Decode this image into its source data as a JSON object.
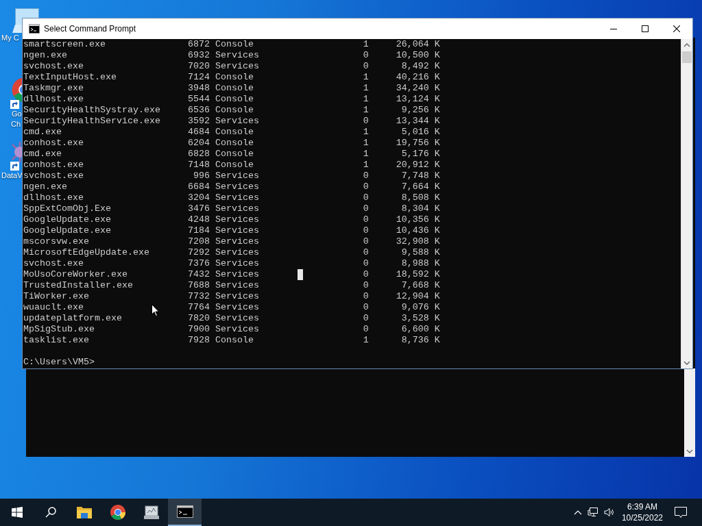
{
  "desktop_icons": [
    {
      "kind": "computer",
      "label_lines": [
        "My C"
      ]
    },
    {
      "kind": "browser",
      "label_lines": [
        "Go",
        "Ch"
      ]
    },
    {
      "kind": "dataview",
      "label_lines": [
        "DataV"
      ]
    }
  ],
  "console_window": {
    "title": "Select Command Prompt",
    "rows": [
      {
        "name": "smartscreen.exe",
        "pid": "6872",
        "session_name": "Console",
        "session_num": "1",
        "mem_usage": "26,064 K"
      },
      {
        "name": "ngen.exe",
        "pid": "6932",
        "session_name": "Services",
        "session_num": "0",
        "mem_usage": "10,500 K"
      },
      {
        "name": "svchost.exe",
        "pid": "7020",
        "session_name": "Services",
        "session_num": "0",
        "mem_usage": "8,492 K"
      },
      {
        "name": "TextInputHost.exe",
        "pid": "7124",
        "session_name": "Console",
        "session_num": "1",
        "mem_usage": "40,216 K"
      },
      {
        "name": "Taskmgr.exe",
        "pid": "3948",
        "session_name": "Console",
        "session_num": "1",
        "mem_usage": "34,240 K"
      },
      {
        "name": "dllhost.exe",
        "pid": "5544",
        "session_name": "Console",
        "session_num": "1",
        "mem_usage": "13,124 K"
      },
      {
        "name": "SecurityHealthSystray.exe",
        "pid": "6536",
        "session_name": "Console",
        "session_num": "1",
        "mem_usage": "9,256 K"
      },
      {
        "name": "SecurityHealthService.exe",
        "pid": "3592",
        "session_name": "Services",
        "session_num": "0",
        "mem_usage": "13,344 K"
      },
      {
        "name": "cmd.exe",
        "pid": "4684",
        "session_name": "Console",
        "session_num": "1",
        "mem_usage": "5,016 K"
      },
      {
        "name": "conhost.exe",
        "pid": "6204",
        "session_name": "Console",
        "session_num": "1",
        "mem_usage": "19,756 K"
      },
      {
        "name": "cmd.exe",
        "pid": "6828",
        "session_name": "Console",
        "session_num": "1",
        "mem_usage": "5,176 K"
      },
      {
        "name": "conhost.exe",
        "pid": "7148",
        "session_name": "Console",
        "session_num": "1",
        "mem_usage": "20,912 K"
      },
      {
        "name": "svchost.exe",
        "pid": "996",
        "session_name": "Services",
        "session_num": "0",
        "mem_usage": "7,748 K"
      },
      {
        "name": "ngen.exe",
        "pid": "6684",
        "session_name": "Services",
        "session_num": "0",
        "mem_usage": "7,664 K"
      },
      {
        "name": "dllhost.exe",
        "pid": "3204",
        "session_name": "Services",
        "session_num": "0",
        "mem_usage": "8,508 K"
      },
      {
        "name": "SppExtComObj.Exe",
        "pid": "3476",
        "session_name": "Services",
        "session_num": "0",
        "mem_usage": "8,304 K"
      },
      {
        "name": "GoogleUpdate.exe",
        "pid": "4248",
        "session_name": "Services",
        "session_num": "0",
        "mem_usage": "10,356 K"
      },
      {
        "name": "GoogleUpdate.exe",
        "pid": "7184",
        "session_name": "Services",
        "session_num": "0",
        "mem_usage": "10,436 K"
      },
      {
        "name": "mscorsvw.exe",
        "pid": "7208",
        "session_name": "Services",
        "session_num": "0",
        "mem_usage": "32,908 K"
      },
      {
        "name": "MicrosoftEdgeUpdate.exe",
        "pid": "7292",
        "session_name": "Services",
        "session_num": "0",
        "mem_usage": "9,588 K"
      },
      {
        "name": "svchost.exe",
        "pid": "7376",
        "session_name": "Services",
        "session_num": "0",
        "mem_usage": "8,988 K"
      },
      {
        "name": "MoUsoCoreWorker.exe",
        "pid": "7432",
        "session_name": "Services",
        "session_num": "0",
        "mem_usage": "18,592 K"
      },
      {
        "name": "TrustedInstaller.exe",
        "pid": "7688",
        "session_name": "Services",
        "session_num": "0",
        "mem_usage": "7,668 K"
      },
      {
        "name": "TiWorker.exe",
        "pid": "7732",
        "session_name": "Services",
        "session_num": "0",
        "mem_usage": "12,904 K"
      },
      {
        "name": "wuauclt.exe",
        "pid": "7764",
        "session_name": "Services",
        "session_num": "0",
        "mem_usage": "9,076 K"
      },
      {
        "name": "updateplatform.exe",
        "pid": "7820",
        "session_name": "Services",
        "session_num": "0",
        "mem_usage": "3,528 K"
      },
      {
        "name": "MpSigStub.exe",
        "pid": "7900",
        "session_name": "Services",
        "session_num": "0",
        "mem_usage": "6,600 K"
      },
      {
        "name": "tasklist.exe",
        "pid": "7928",
        "session_name": "Console",
        "session_num": "1",
        "mem_usage": "8,736 K"
      }
    ],
    "prompt": "C:\\Users\\VM5>"
  },
  "taskbar": {
    "items": [
      {
        "kind": "start",
        "selected": false
      },
      {
        "kind": "search",
        "selected": false
      },
      {
        "kind": "explorer",
        "selected": false
      },
      {
        "kind": "browser",
        "selected": false
      },
      {
        "kind": "monitor",
        "selected": false
      },
      {
        "kind": "terminal",
        "selected": true
      }
    ],
    "clock": {
      "time": "6:39 AM",
      "date": "10/25/2022"
    }
  }
}
